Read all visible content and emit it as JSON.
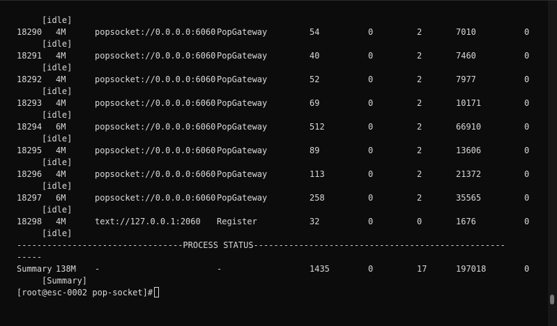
{
  "colors": {
    "background": "#0c0c0c",
    "foreground": "#d9d9d9",
    "scrollbar_track": "#171717",
    "scrollbar_thumb": "#777777"
  },
  "first_status": "[idle]",
  "rows": [
    {
      "pid": "18290",
      "memory": "4M",
      "listening": "popsocket://0.0.0.0:6060",
      "name": "PopGateway",
      "connections": "54",
      "fail": "0",
      "timers": "2",
      "total_request": "7010",
      "qps": "0",
      "status": "[idle]"
    },
    {
      "pid": "18291",
      "memory": "4M",
      "listening": "popsocket://0.0.0.0:6060",
      "name": "PopGateway",
      "connections": "40",
      "fail": "0",
      "timers": "2",
      "total_request": "7460",
      "qps": "0",
      "status": "[idle]"
    },
    {
      "pid": "18292",
      "memory": "4M",
      "listening": "popsocket://0.0.0.0:6060",
      "name": "PopGateway",
      "connections": "52",
      "fail": "0",
      "timers": "2",
      "total_request": "7977",
      "qps": "0",
      "status": "[idle]"
    },
    {
      "pid": "18293",
      "memory": "4M",
      "listening": "popsocket://0.0.0.0:6060",
      "name": "PopGateway",
      "connections": "69",
      "fail": "0",
      "timers": "2",
      "total_request": "10171",
      "qps": "0",
      "status": "[idle]"
    },
    {
      "pid": "18294",
      "memory": "6M",
      "listening": "popsocket://0.0.0.0:6060",
      "name": "PopGateway",
      "connections": "512",
      "fail": "0",
      "timers": "2",
      "total_request": "66910",
      "qps": "0",
      "status": "[idle]"
    },
    {
      "pid": "18295",
      "memory": "4M",
      "listening": "popsocket://0.0.0.0:6060",
      "name": "PopGateway",
      "connections": "89",
      "fail": "0",
      "timers": "2",
      "total_request": "13606",
      "qps": "0",
      "status": "[idle]"
    },
    {
      "pid": "18296",
      "memory": "4M",
      "listening": "popsocket://0.0.0.0:6060",
      "name": "PopGateway",
      "connections": "113",
      "fail": "0",
      "timers": "2",
      "total_request": "21372",
      "qps": "0",
      "status": "[idle]"
    },
    {
      "pid": "18297",
      "memory": "6M",
      "listening": "popsocket://0.0.0.0:6060",
      "name": "PopGateway",
      "connections": "258",
      "fail": "0",
      "timers": "2",
      "total_request": "35565",
      "qps": "0",
      "status": "[idle]"
    },
    {
      "pid": "18298",
      "memory": "4M",
      "listening": "text://127.0.0.1:2060",
      "name": "Register",
      "connections": "32",
      "fail": "0",
      "timers": "0",
      "total_request": "1676",
      "qps": "0",
      "status": "[idle]"
    }
  ],
  "separator": {
    "line1": "---------------------------------PROCESS STATUS--------------------------------------------------",
    "line2": "-----"
  },
  "summary": {
    "label": "Summary",
    "memory": "138M",
    "listening": "-",
    "name": "-",
    "connections": "1435",
    "fail": "0",
    "timers": "17",
    "total_request": "197018",
    "qps": "0",
    "status": "[Summary]"
  },
  "prompt": "[root@esc-0002 pop-socket]#"
}
